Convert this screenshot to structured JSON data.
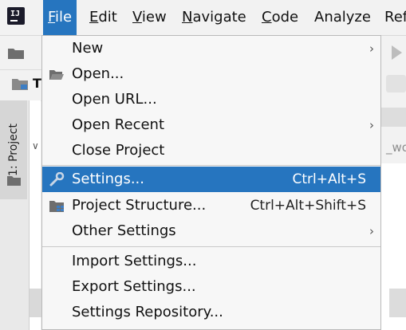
{
  "colors": {
    "accent": "#2675bf",
    "menu_bg": "#f7f7f7"
  },
  "menubar": {
    "items": [
      {
        "label": "File",
        "mnemonic": "F",
        "rest": "ile"
      },
      {
        "label": "Edit",
        "mnemonic": "E",
        "rest": "dit"
      },
      {
        "label": "View",
        "mnemonic": "V",
        "rest": "iew"
      },
      {
        "label": "Navigate",
        "mnemonic": "N",
        "rest": "avigate"
      },
      {
        "label": "Code",
        "mnemonic": "C",
        "rest": "ode"
      },
      {
        "label": "Analyze",
        "mnemonic": "",
        "rest": "Analyze"
      },
      {
        "label": "Ref",
        "mnemonic": "",
        "rest": "Ref"
      }
    ]
  },
  "background": {
    "nav_text": "T",
    "side_tab_label": "1: Project",
    "right_partial_text": "_wo"
  },
  "file_menu": {
    "items": [
      {
        "label": "New",
        "shortcut": "",
        "submenu": true,
        "icon": ""
      },
      {
        "label": "Open...",
        "shortcut": "",
        "submenu": false,
        "icon": "open-folder-icon"
      },
      {
        "label": "Open URL...",
        "shortcut": "",
        "submenu": false,
        "icon": ""
      },
      {
        "label": "Open Recent",
        "shortcut": "",
        "submenu": true,
        "icon": ""
      },
      {
        "label": "Close Project",
        "shortcut": "",
        "submenu": false,
        "icon": ""
      },
      {
        "label": "Settings...",
        "shortcut": "Ctrl+Alt+S",
        "submenu": false,
        "icon": "wrench-icon",
        "highlighted": true
      },
      {
        "label": "Project Structure...",
        "shortcut": "Ctrl+Alt+Shift+S",
        "submenu": false,
        "icon": "project-structure-icon"
      },
      {
        "label": "Other Settings",
        "shortcut": "",
        "submenu": true,
        "icon": ""
      },
      {
        "label": "Import Settings...",
        "shortcut": "",
        "submenu": false,
        "icon": ""
      },
      {
        "label": "Export Settings...",
        "shortcut": "",
        "submenu": false,
        "icon": ""
      },
      {
        "label": "Settings Repository...",
        "shortcut": "",
        "submenu": false,
        "icon": ""
      }
    ],
    "submenu_glyph": "›"
  }
}
